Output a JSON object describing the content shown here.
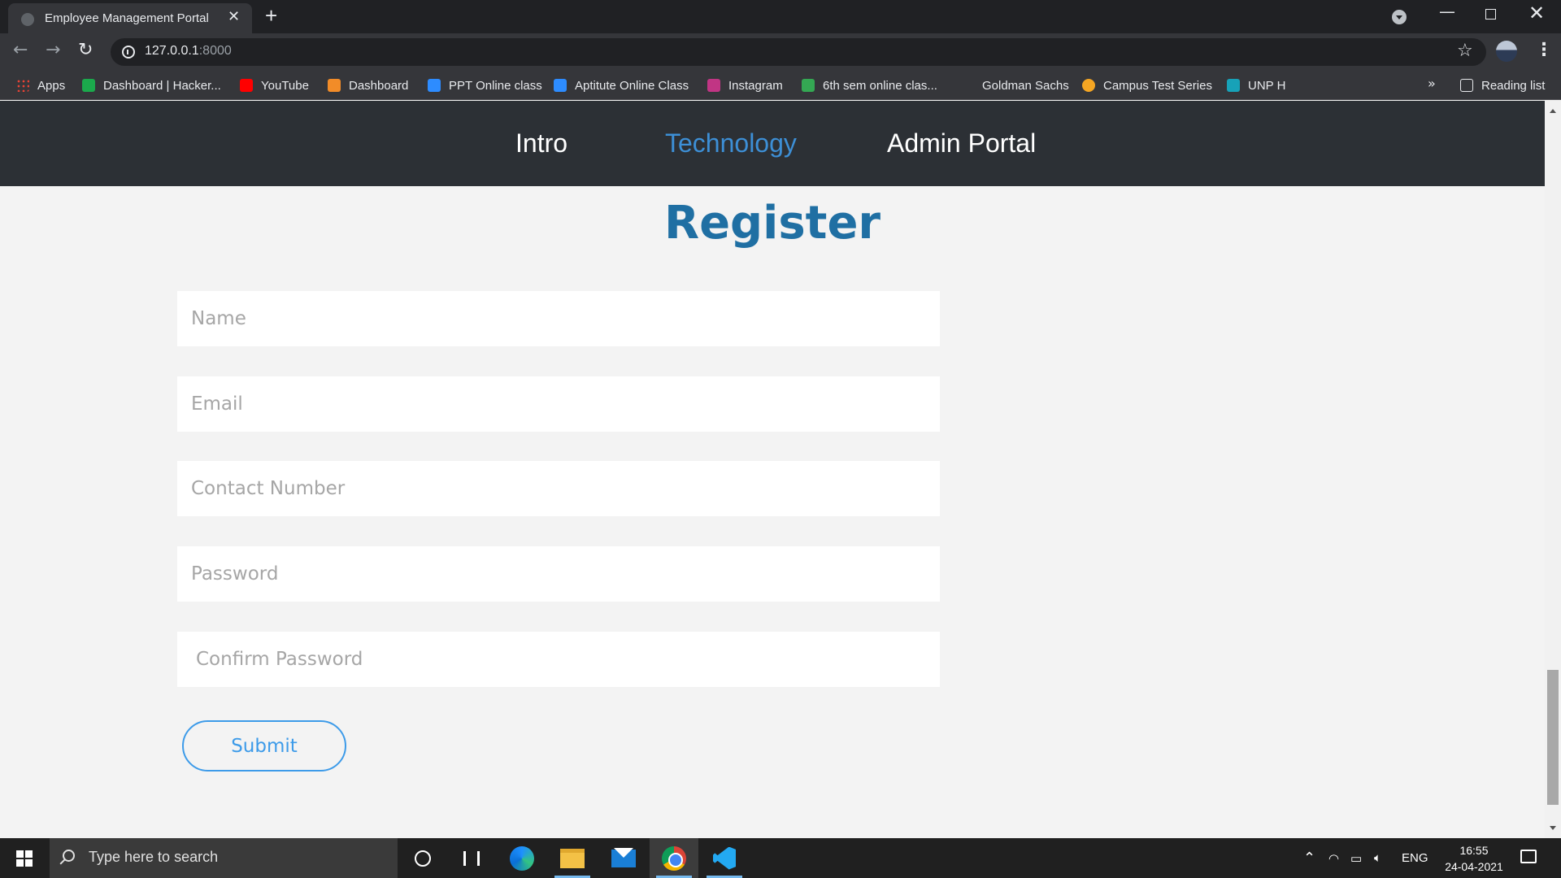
{
  "browser": {
    "tab_title": "Employee Management Portal",
    "tab_close": "✕",
    "new_tab": "+",
    "url_host": "127.0.0.1",
    "url_port": ":8000",
    "bookmarks": [
      {
        "label": "Apps",
        "color": "#ea4335"
      },
      {
        "label": "Dashboard | Hacker...",
        "color": "#1ba94c"
      },
      {
        "label": "YouTube",
        "color": "#ff0000"
      },
      {
        "label": "Dashboard",
        "color": "#f28c28"
      },
      {
        "label": "PPT Online class",
        "color": "#2d8cff"
      },
      {
        "label": "Aptitute Online Class",
        "color": "#2d8cff"
      },
      {
        "label": "Instagram",
        "color": "#c13584"
      },
      {
        "label": "6th sem online clas...",
        "color": "#34a853"
      },
      {
        "label": "Goldman Sachs",
        "color": "#35363a"
      },
      {
        "label": "Campus Test Series",
        "color": "#f5a623"
      },
      {
        "label": "UNP H",
        "color": "#17a2b8"
      }
    ],
    "bookmarks_more": "»",
    "reading_list": "Reading list"
  },
  "site": {
    "nav": [
      {
        "label": "Intro",
        "active": false
      },
      {
        "label": "Technology",
        "active": true
      },
      {
        "label": "Admin Portal",
        "active": false
      }
    ],
    "accent_color": "#3d9be9",
    "title_color": "#1f6fa3"
  },
  "form": {
    "title": "Register",
    "fields": {
      "name": {
        "placeholder": "Name",
        "value": ""
      },
      "email": {
        "placeholder": "Email",
        "value": ""
      },
      "contact": {
        "placeholder": "Contact Number",
        "value": ""
      },
      "password": {
        "placeholder": "Password",
        "value": ""
      },
      "confirm": {
        "placeholder": "Confirm Password",
        "value": ""
      }
    },
    "submit_label": "Submit"
  },
  "taskbar": {
    "search_placeholder": "Type here to search",
    "apps": [
      "cortana-icon",
      "task-view-icon",
      "edge-icon",
      "file-explorer-icon",
      "mail-icon",
      "chrome-icon",
      "vscode-icon"
    ],
    "language": "ENG",
    "time": "16:55",
    "date": "24-04-2021"
  }
}
